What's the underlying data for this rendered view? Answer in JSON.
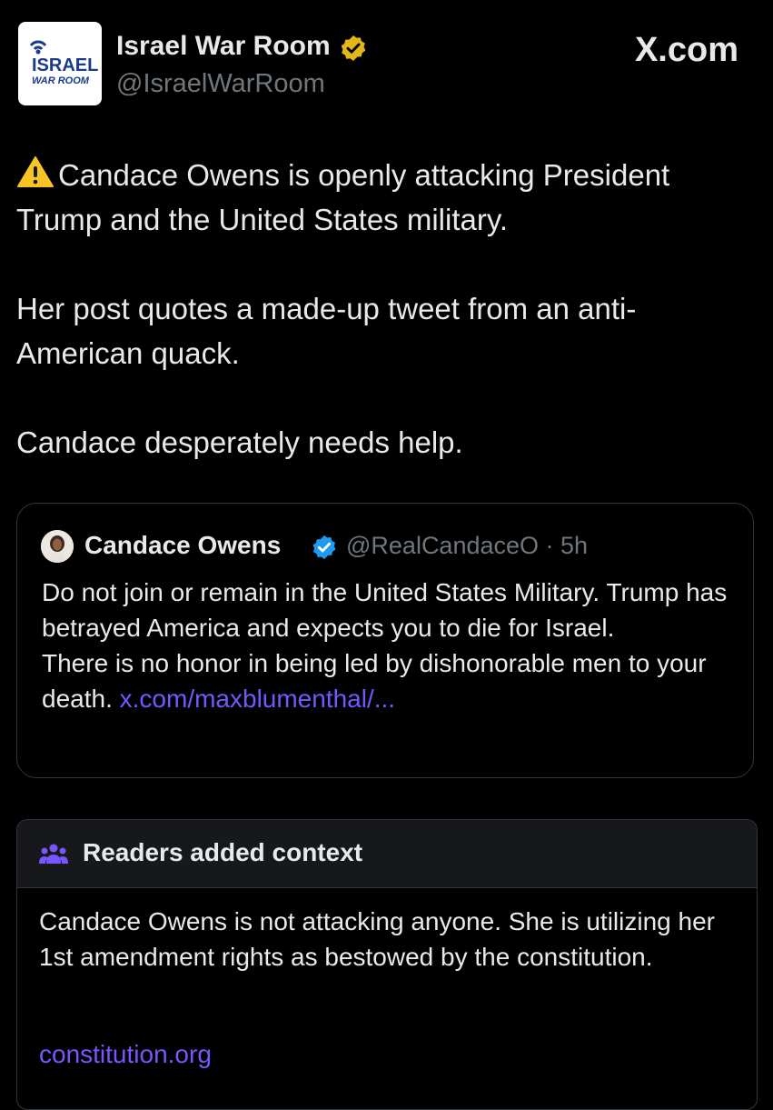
{
  "post": {
    "author_name": "Israel War Room",
    "handle": "@IsraelWarRoom",
    "verified_badge": "gold-verified-badge-icon",
    "site_label": "X.com",
    "avatar_logo_text": [
      "ISRAEL",
      "WAR ROOM"
    ],
    "warning_icon": "warning-triangle-icon",
    "paragraphs": [
      "Candace Owens is openly attacking President Trump and the United States military.",
      "Her post quotes a made-up tweet from an anti-American quack.",
      "Candace desperately needs help."
    ]
  },
  "quoted_post": {
    "author_name": "Candace Owens",
    "verified_badge": "blue-verified-badge-icon",
    "handle_time": "@RealCandaceO · 5h",
    "lines": [
      "Do not join or remain in the United States Military. Trump has betrayed America and expects you to die for Israel.",
      "There is no honor in being led by dishonorable men to your death."
    ],
    "link_text": "x.com/maxblumenthal/..."
  },
  "community_note": {
    "icon": "people-icon",
    "title": "Readers added context",
    "body": "Candace Owens is not attacking anyone. She is utilizing her 1st amendment rights as bestowed by the constitution.",
    "link_text": "constitution.org"
  },
  "colors": {
    "background": "#000000",
    "text": "#e7e9ea",
    "muted": "#71767b",
    "link": "#7856ff",
    "border": "#333639",
    "gold_badge": "#e2b719",
    "blue_badge": "#1d9bf0"
  }
}
